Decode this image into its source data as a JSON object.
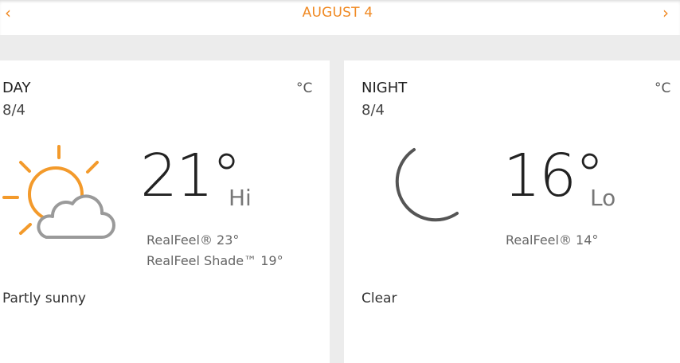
{
  "header": {
    "title": "AUGUST 4",
    "prev_icon": "chevron-left-icon",
    "next_icon": "chevron-right-icon",
    "prev_glyph": "‹",
    "next_glyph": "›",
    "accent_color": "#f08a24"
  },
  "day": {
    "label": "DAY",
    "date": "8/4",
    "unit": "°C",
    "temperature": "21°",
    "temp_kind": "Hi",
    "realfeel": "RealFeel® 23°",
    "realfeel_shade": "RealFeel Shade™ 19°",
    "condition": "Partly sunny",
    "icon": "partly-sunny-icon"
  },
  "night": {
    "label": "NIGHT",
    "date": "8/4",
    "unit": "°C",
    "temperature": "16°",
    "temp_kind": "Lo",
    "realfeel": "RealFeel® 14°",
    "condition": "Clear",
    "icon": "moon-icon"
  }
}
